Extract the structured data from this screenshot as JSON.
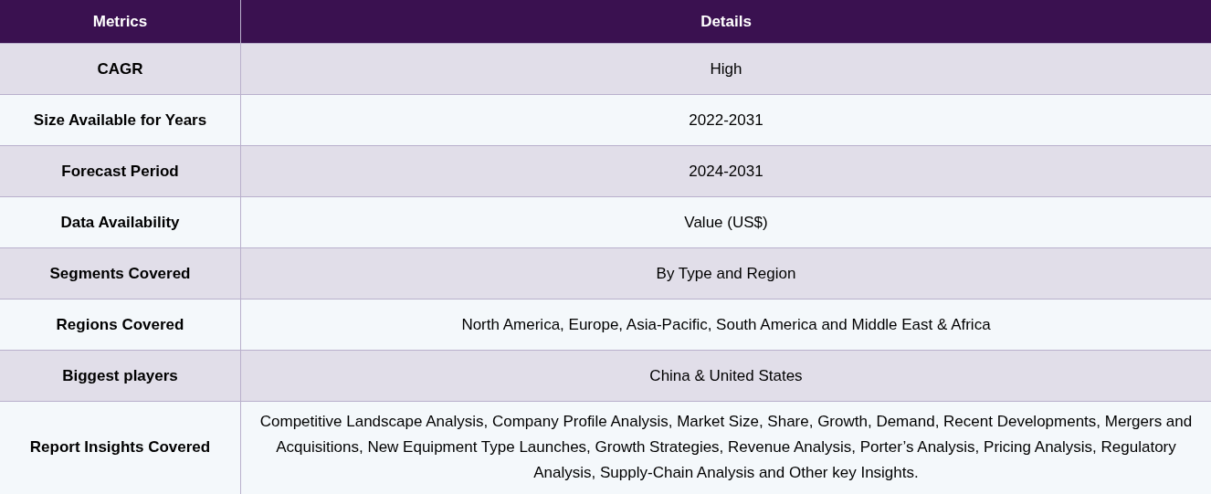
{
  "table": {
    "columns": [
      "Metrics",
      "Details"
    ],
    "rows": [
      {
        "metric": "CAGR",
        "detail": "High"
      },
      {
        "metric": "Size Available for Years",
        "detail": "2022-2031"
      },
      {
        "metric": "Forecast Period",
        "detail": "2024-2031"
      },
      {
        "metric": "Data Availability",
        "detail": "Value (US$)"
      },
      {
        "metric": "Segments Covered",
        "detail": "By Type and Region"
      },
      {
        "metric": "Regions Covered",
        "detail": "North America, Europe, Asia-Pacific, South America and Middle East & Africa"
      },
      {
        "metric": "Biggest players",
        "detail": "China & United States"
      },
      {
        "metric": "Report Insights Covered",
        "detail": "Competitive Landscape Analysis, Company Profile Analysis, Market Size, Share, Growth, Demand, Recent Developments, Mergers and Acquisitions, New Equipment Type Launches, Growth Strategies, Revenue Analysis, Porter’s Analysis, Pricing Analysis, Regulatory Analysis, Supply-Chain Analysis and Other key Insights."
      }
    ]
  }
}
